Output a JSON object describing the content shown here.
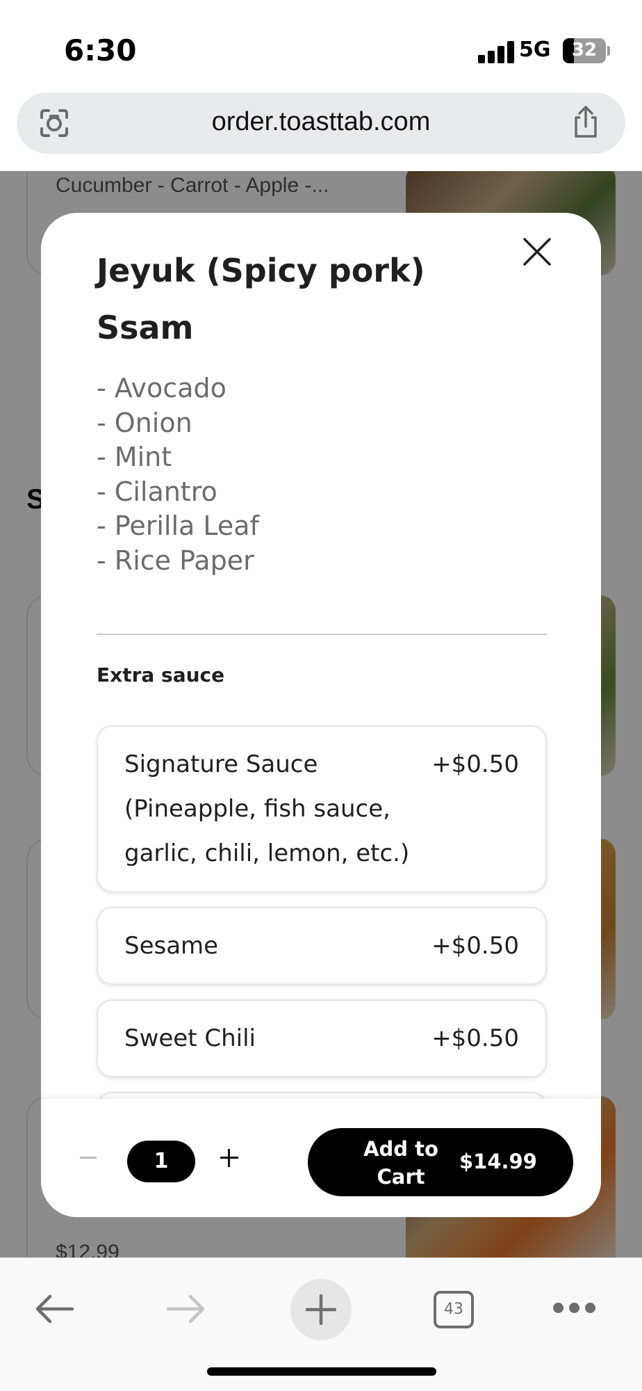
{
  "status_bar": {
    "time": "6:30",
    "network": "5G",
    "battery": "32"
  },
  "browser": {
    "url": "order.toasttab.com",
    "tabs_count": "43"
  },
  "background_page": {
    "card_text": "Cucumber - Carrot - Apple -...",
    "section_letter": "S",
    "price": "$12.99"
  },
  "modal": {
    "title": "Jeyuk (Spicy pork) Ssam",
    "description": [
      "- Avocado",
      "- Onion",
      "- Mint",
      "- Cilantro",
      "- Perilla Leaf",
      "- Rice Paper"
    ],
    "group_title": "Extra sauce",
    "options": [
      {
        "name": "Signature Sauce (Pineapple, fish sauce, garlic, chili, lemon, etc.)",
        "price": "+$0.50"
      },
      {
        "name": "Sesame",
        "price": "+$0.50"
      },
      {
        "name": "Sweet Chili",
        "price": "+$0.50"
      }
    ],
    "footer": {
      "quantity": "1",
      "minus_symbol": "−",
      "plus_symbol": "+",
      "add_to_cart_label": "Add to Cart",
      "total_price": "$14.99"
    }
  },
  "colors": {
    "accent": "#000000",
    "dim_overlay": "rgba(0,0,0,0.45)",
    "muted_text": "#6b6b6b"
  },
  "icons": [
    "lens-icon",
    "share-icon",
    "close-icon",
    "back-arrow-icon",
    "forward-arrow-icon",
    "plus-icon",
    "tabs-icon",
    "more-icon",
    "signal-icon",
    "battery-icon"
  ]
}
